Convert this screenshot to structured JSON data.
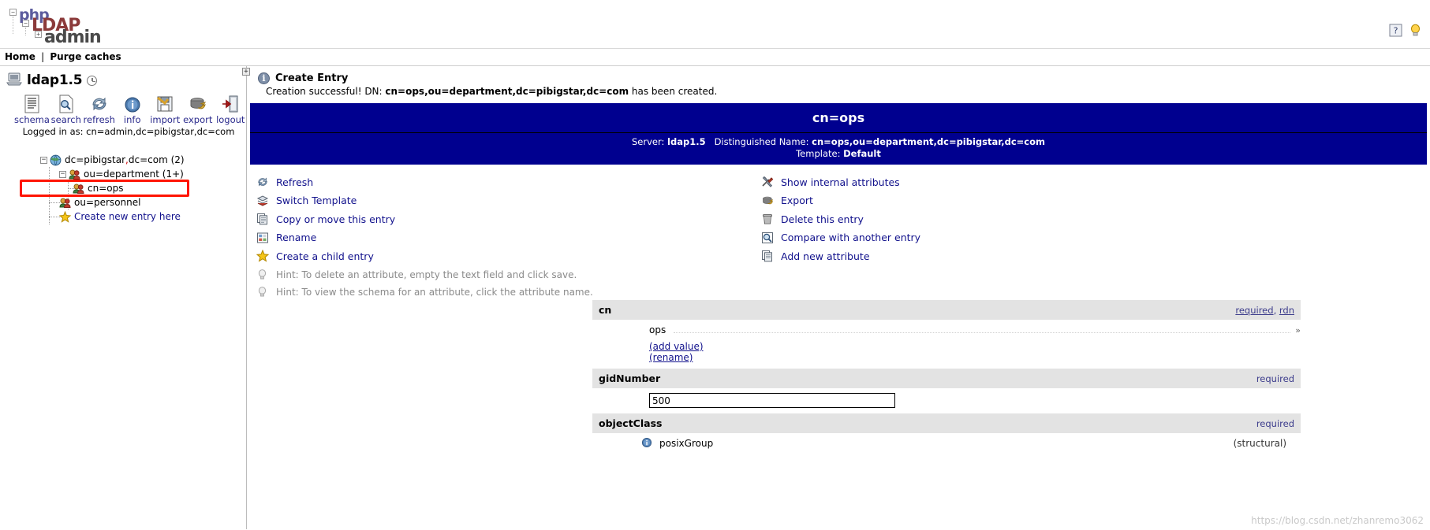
{
  "app": {
    "logo_php": "php",
    "logo_ldap": "LDAP",
    "logo_admin": "admin"
  },
  "topicons": [
    {
      "name": "help-icon",
      "glyph": "?"
    },
    {
      "name": "lightbulb-icon",
      "glyph": "●"
    }
  ],
  "navbar": {
    "home": "Home",
    "separator": "|",
    "purge": "Purge caches"
  },
  "sidebar": {
    "server_name": "ldap1.5",
    "toolbar": [
      {
        "label": "schema",
        "icon": "schema-icon"
      },
      {
        "label": "search",
        "icon": "search-icon"
      },
      {
        "label": "refresh",
        "icon": "refresh-icon"
      },
      {
        "label": "info",
        "icon": "info-icon"
      },
      {
        "label": "import",
        "icon": "import-icon"
      },
      {
        "label": "export",
        "icon": "export-icon"
      },
      {
        "label": "logout",
        "icon": "logout-icon"
      }
    ],
    "logged_in_as": "Logged in as: cn=admin,dc=pibigstar,dc=com",
    "tree": {
      "root_label_1": "dc=pibigstar",
      "root_comma": ",",
      "root_label_2": "dc=com (2)",
      "child_department": "ou=department (1+)",
      "child_ops": "cn=ops",
      "child_personnel": "ou=personnel",
      "create_new": "Create new entry here",
      "expander_open": "−"
    }
  },
  "main": {
    "notice": {
      "title": "Create Entry",
      "message_pre": "Creation successful! DN: ",
      "message_dn": "cn=ops,ou=department,dc=pibigstar,dc=com",
      "message_post": " has been created."
    },
    "entry_header": {
      "title": "cn=ops",
      "server_label": "Server:",
      "server_value": "ldap1.5",
      "dn_label": "Distinguished Name:",
      "dn_value": "cn=ops,ou=department,dc=pibigstar,dc=com",
      "template_label": "Template:",
      "template_value": "Default"
    },
    "actions_left": [
      {
        "label": "Refresh",
        "icon": "refresh-icon"
      },
      {
        "label": "Switch Template",
        "icon": "template-icon"
      },
      {
        "label": "Copy or move this entry",
        "icon": "copy-icon"
      },
      {
        "label": "Rename",
        "icon": "rename-icon"
      },
      {
        "label": "Create a child entry",
        "icon": "star-icon"
      }
    ],
    "actions_right": [
      {
        "label": "Show internal attributes",
        "icon": "tools-icon"
      },
      {
        "label": "Export",
        "icon": "export-icon"
      },
      {
        "label": "Delete this entry",
        "icon": "trash-icon"
      },
      {
        "label": "Compare with another entry",
        "icon": "compare-icon"
      },
      {
        "label": "Add new attribute",
        "icon": "add-attribute-icon"
      }
    ],
    "hints": [
      {
        "text": "Hint: To delete an attribute, empty the text field and click save.",
        "icon": "hint-bulb-icon"
      },
      {
        "text": "Hint: To view the schema for an attribute, click the attribute name.",
        "icon": "hint-bulb-icon"
      }
    ],
    "attributes": [
      {
        "name": "cn",
        "flags": "required, rdn",
        "flag_required": "required",
        "flag_sep": ", ",
        "flag_rdn": "rdn",
        "value": "ops",
        "marker": "»",
        "sublinks": [
          "(add value)",
          "(rename)"
        ]
      },
      {
        "name": "gidNumber",
        "flags": "required",
        "flag_required": "required",
        "value": "500"
      },
      {
        "name": "objectClass",
        "flags": "required",
        "flag_required": "required",
        "value": "posixGroup",
        "structural": "(structural)"
      }
    ]
  },
  "watermark": {
    "line1": "https://blog.csdn.net/zhanremo3062"
  },
  "colors": {
    "header_blue": "#00008f",
    "link_blue": "#11118c",
    "highlight_red": "#ff1400",
    "attr_header_bg": "#e3e3e3"
  }
}
